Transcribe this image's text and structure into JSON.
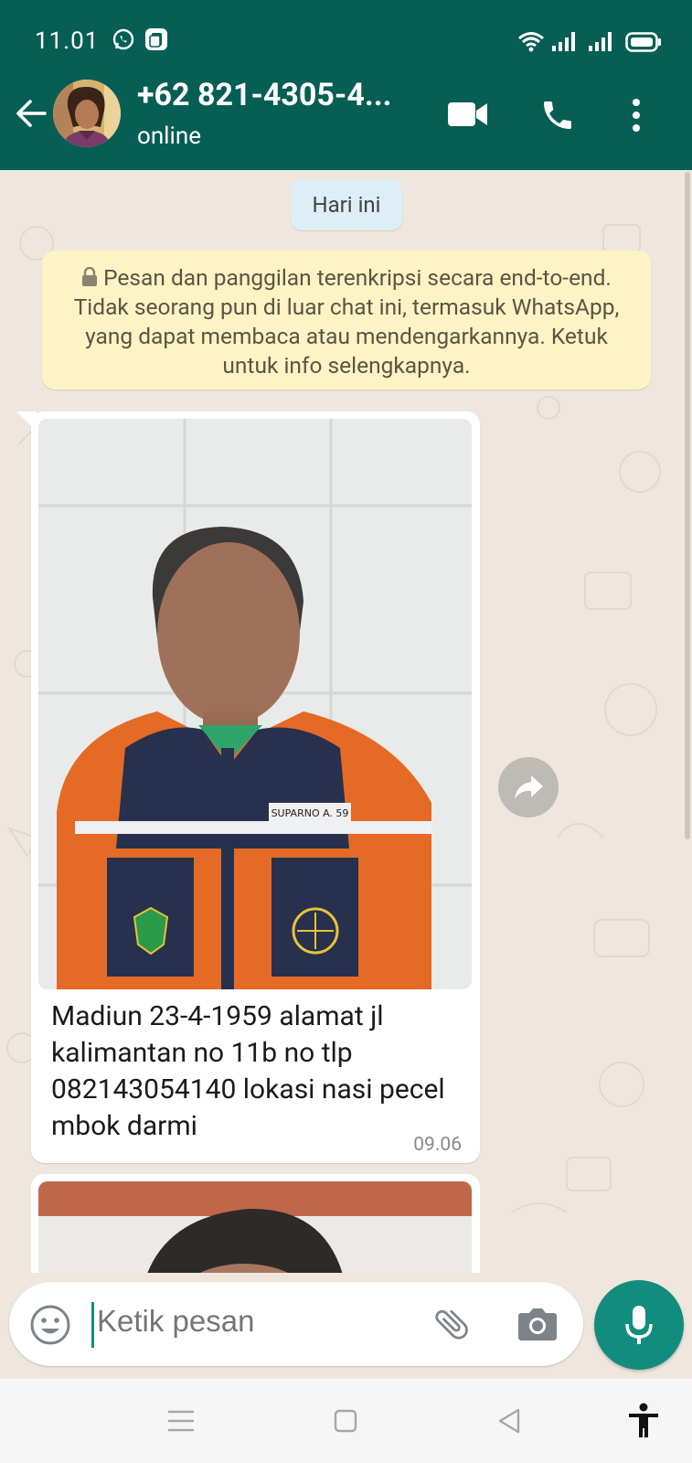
{
  "status_bar": {
    "time": "11.01",
    "icons": [
      "whatsapp-icon",
      "app-icon",
      "wifi-icon",
      "signal-icon",
      "signal-icon",
      "battery-icon"
    ]
  },
  "header": {
    "contact_name": "+62 821-4305-4...",
    "status": "online",
    "icons": [
      "back-arrow-icon",
      "video-call-icon",
      "phone-icon",
      "more-vert-icon"
    ]
  },
  "chat": {
    "date_chip": "Hari ini",
    "encryption_notice": "Pesan dan panggilan terenkripsi secara end-to-end. Tidak seorang pun di luar chat ini, termasuk WhatsApp, yang dapat membaca atau mendengarkannya. Ketuk untuk info selengkapnya.",
    "messages": [
      {
        "type": "image",
        "name_tag": "SUPARNO A. 59",
        "caption": "Madiun 23-4-1959  alamat jl kalimantan no 11b no tlp 082143054140  lokasi nasi pecel mbok darmi",
        "time": "09.06"
      }
    ]
  },
  "composer": {
    "placeholder": "Ketik pesan",
    "icons": [
      "emoji-icon",
      "attach-icon",
      "camera-icon",
      "mic-icon"
    ]
  },
  "colors": {
    "header": "#075e54",
    "accent": "#128c7e",
    "chat_background": "#efe7de",
    "notice_background": "#fdf3c5",
    "date_chip_background": "#ddeef6"
  }
}
